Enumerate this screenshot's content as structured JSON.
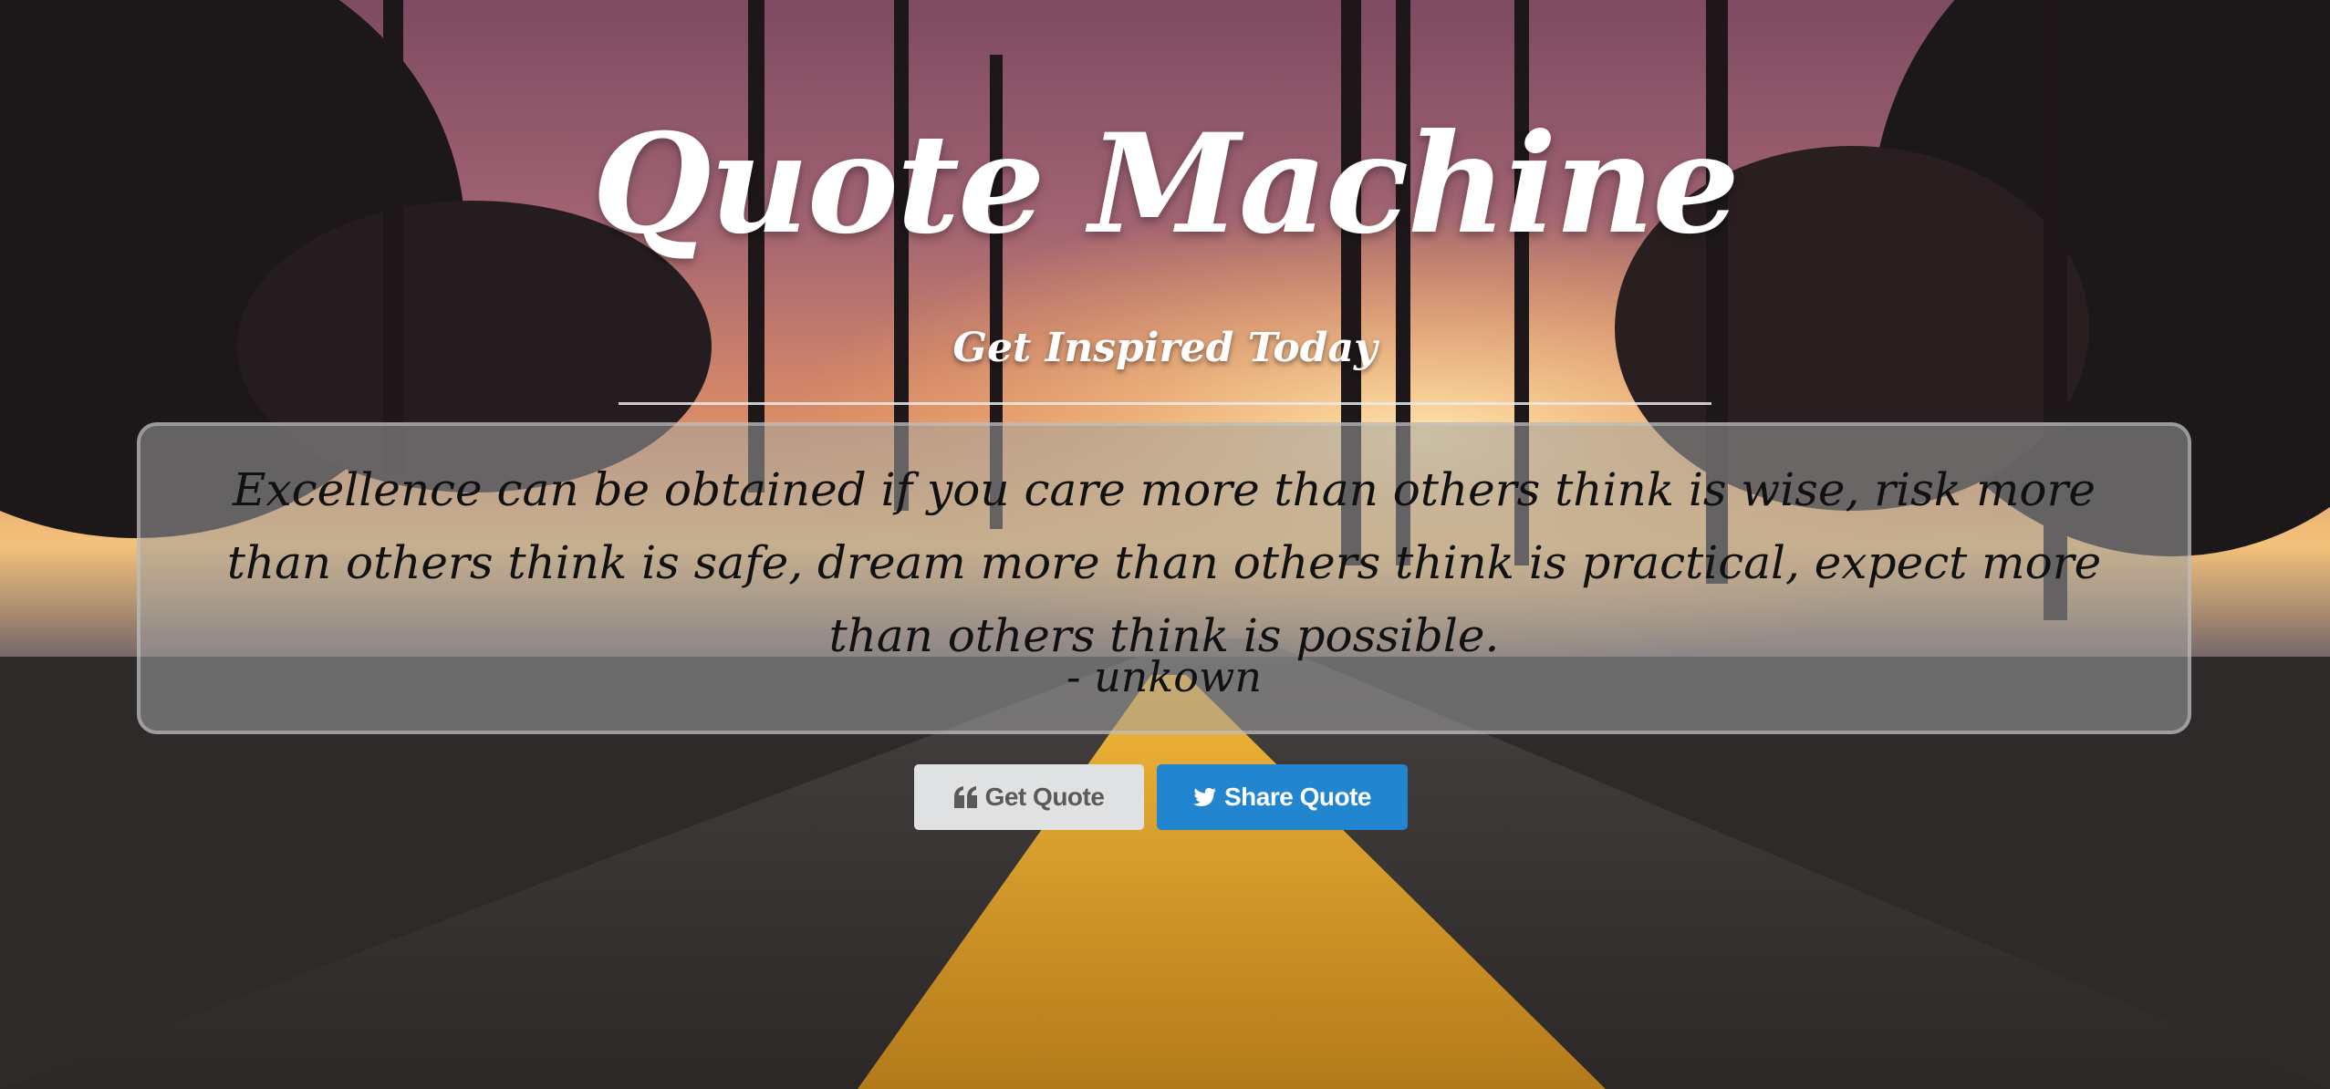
{
  "header": {
    "title": "Quote Machine",
    "subtitle": "Get Inspired Today"
  },
  "quote": {
    "text": "Excellence can be obtained if you care more than others think is wise, risk more than others think is safe, dream more than others think is practical, expect more than others think is possible.",
    "author": "- unkown"
  },
  "buttons": {
    "get_quote": {
      "label": "Get Quote",
      "icon": "quote-left-icon"
    },
    "share_quote": {
      "label": "Share Quote",
      "icon": "twitter-icon"
    }
  },
  "colors": {
    "share_button": "#2185d0",
    "get_button": "#e0e1e2",
    "title_text": "#ffffff"
  }
}
